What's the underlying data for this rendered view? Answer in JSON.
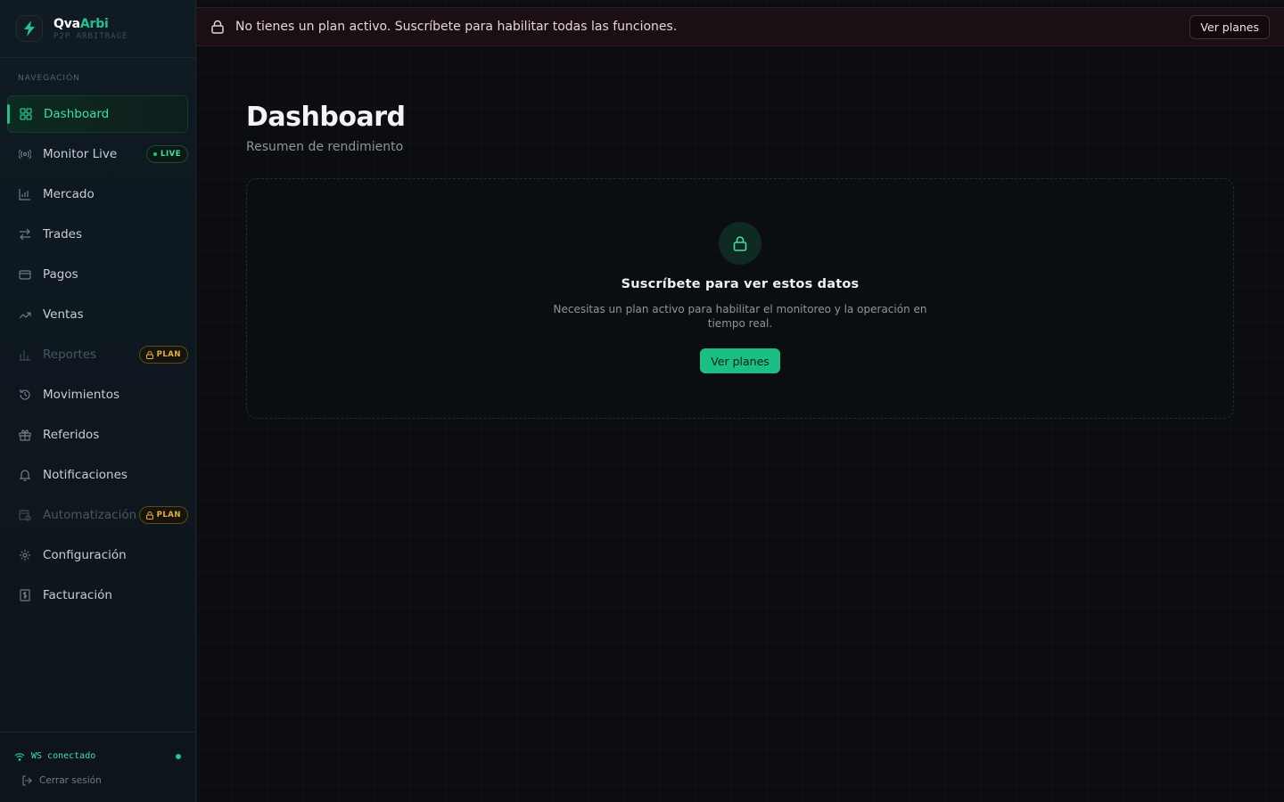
{
  "brand": {
    "name_part1": "Qva",
    "name_part2": "Arbi",
    "subtitle": "P2P ARBITRAGE"
  },
  "sidebar": {
    "heading": "NAVEGACIÓN",
    "items": [
      {
        "label": "Dashboard",
        "icon": "grid-icon",
        "active": true
      },
      {
        "label": "Monitor Live",
        "icon": "radio-icon",
        "badge": "LIVE"
      },
      {
        "label": "Mercado",
        "icon": "chart-icon"
      },
      {
        "label": "Trades",
        "icon": "arrows-swap-icon"
      },
      {
        "label": "Pagos",
        "icon": "credit-card-icon"
      },
      {
        "label": "Ventas",
        "icon": "trend-up-icon"
      },
      {
        "label": "Reportes",
        "icon": "bar-chart-icon",
        "badge": "PLAN",
        "disabled": true
      },
      {
        "label": "Movimientos",
        "icon": "history-icon"
      },
      {
        "label": "Referidos",
        "icon": "gift-icon"
      },
      {
        "label": "Notificaciones",
        "icon": "bell-icon"
      },
      {
        "label": "Automatización",
        "icon": "calendar-clock-icon",
        "badge": "PLAN",
        "disabled": true
      },
      {
        "label": "Configuración",
        "icon": "gear-icon"
      },
      {
        "label": "Facturación",
        "icon": "receipt-icon"
      }
    ],
    "footer": {
      "ws_status": "WS conectado",
      "logout": "Cerrar sesión"
    }
  },
  "banner": {
    "text": "No tienes un plan activo. Suscríbete para habilitar todas las funciones.",
    "button": "Ver planes"
  },
  "page": {
    "title": "Dashboard",
    "subtitle": "Resumen de rendimiento"
  },
  "locked_card": {
    "title": "Suscríbete para ver estos datos",
    "description": "Necesitas un plan activo para habilitar el monitoreo y la operación en tiempo real.",
    "button": "Ver planes"
  },
  "colors": {
    "accent": "#22c38a",
    "warning": "#e0b13f",
    "danger_bg": "#1a0f14"
  }
}
